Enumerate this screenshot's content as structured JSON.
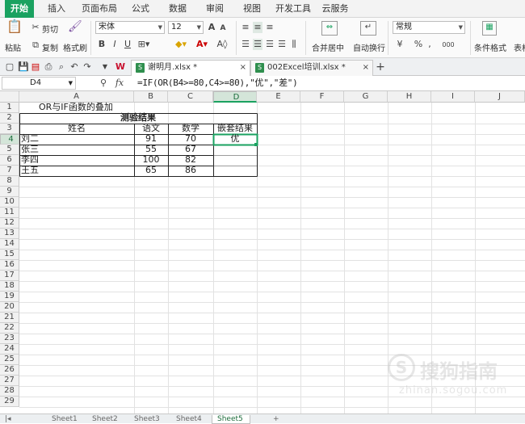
{
  "menu": {
    "tabs": [
      "开始",
      "插入",
      "页面布局",
      "公式",
      "数据",
      "审阅",
      "视图",
      "开发工具",
      "云服务"
    ],
    "active": "开始"
  },
  "ribbon": {
    "paste": "粘贴",
    "cut": "剪切",
    "copy": "复制",
    "format_painter": "格式刷",
    "font_name": "宋体",
    "font_size": "12",
    "bold": "B",
    "italic": "I",
    "underline": "U",
    "grow_font": "A",
    "shrink_font": "A",
    "merge_center": "合并居中",
    "auto_wrap": "自动换行",
    "number_format": "常规",
    "currency": "¥",
    "percent": "%",
    "thousands": "000",
    "conditional_format": "条件格式",
    "table_style": "表格"
  },
  "doc_tabs": [
    {
      "name": "谢明月.xlsx *",
      "active": true
    },
    {
      "name": "002Excel培训.xlsx *",
      "active": false
    }
  ],
  "formula_bar": {
    "name_box": "D4",
    "fx": "fx",
    "formula": "=IF(OR(B4>=80,C4>=80),\"优\",\"差\")"
  },
  "columns": [
    "A",
    "B",
    "C",
    "D",
    "E",
    "F",
    "G",
    "H",
    "I",
    "J"
  ],
  "rows": [
    "1",
    "2",
    "3",
    "4",
    "5",
    "6",
    "7",
    "8",
    "9",
    "10",
    "11",
    "12",
    "13",
    "14",
    "15",
    "16",
    "17",
    "18",
    "19",
    "20",
    "21",
    "22",
    "23",
    "24",
    "25",
    "26",
    "27",
    "28",
    "29"
  ],
  "sheet": {
    "a1": "OR与IF函数的叠加",
    "table_title": "测验结果",
    "headers": [
      "姓名",
      "语文",
      "数学",
      "嵌套结果"
    ],
    "records": [
      {
        "name": "刘二",
        "chinese": "91",
        "math": "70",
        "result": "优"
      },
      {
        "name": "张三",
        "chinese": "55",
        "math": "67",
        "result": ""
      },
      {
        "name": "李四",
        "chinese": "100",
        "math": "82",
        "result": ""
      },
      {
        "name": "王五",
        "chinese": "65",
        "math": "86",
        "result": ""
      }
    ]
  },
  "sheet_tabs": [
    "Sheet1",
    "Sheet2",
    "Sheet3",
    "Sheet4",
    "Sheet5"
  ],
  "watermark": {
    "title": "搜狗指南",
    "url": "zhinan.sogou.com"
  },
  "colors": {
    "accent": "#1aa260",
    "selection": "#d4e5d9"
  }
}
